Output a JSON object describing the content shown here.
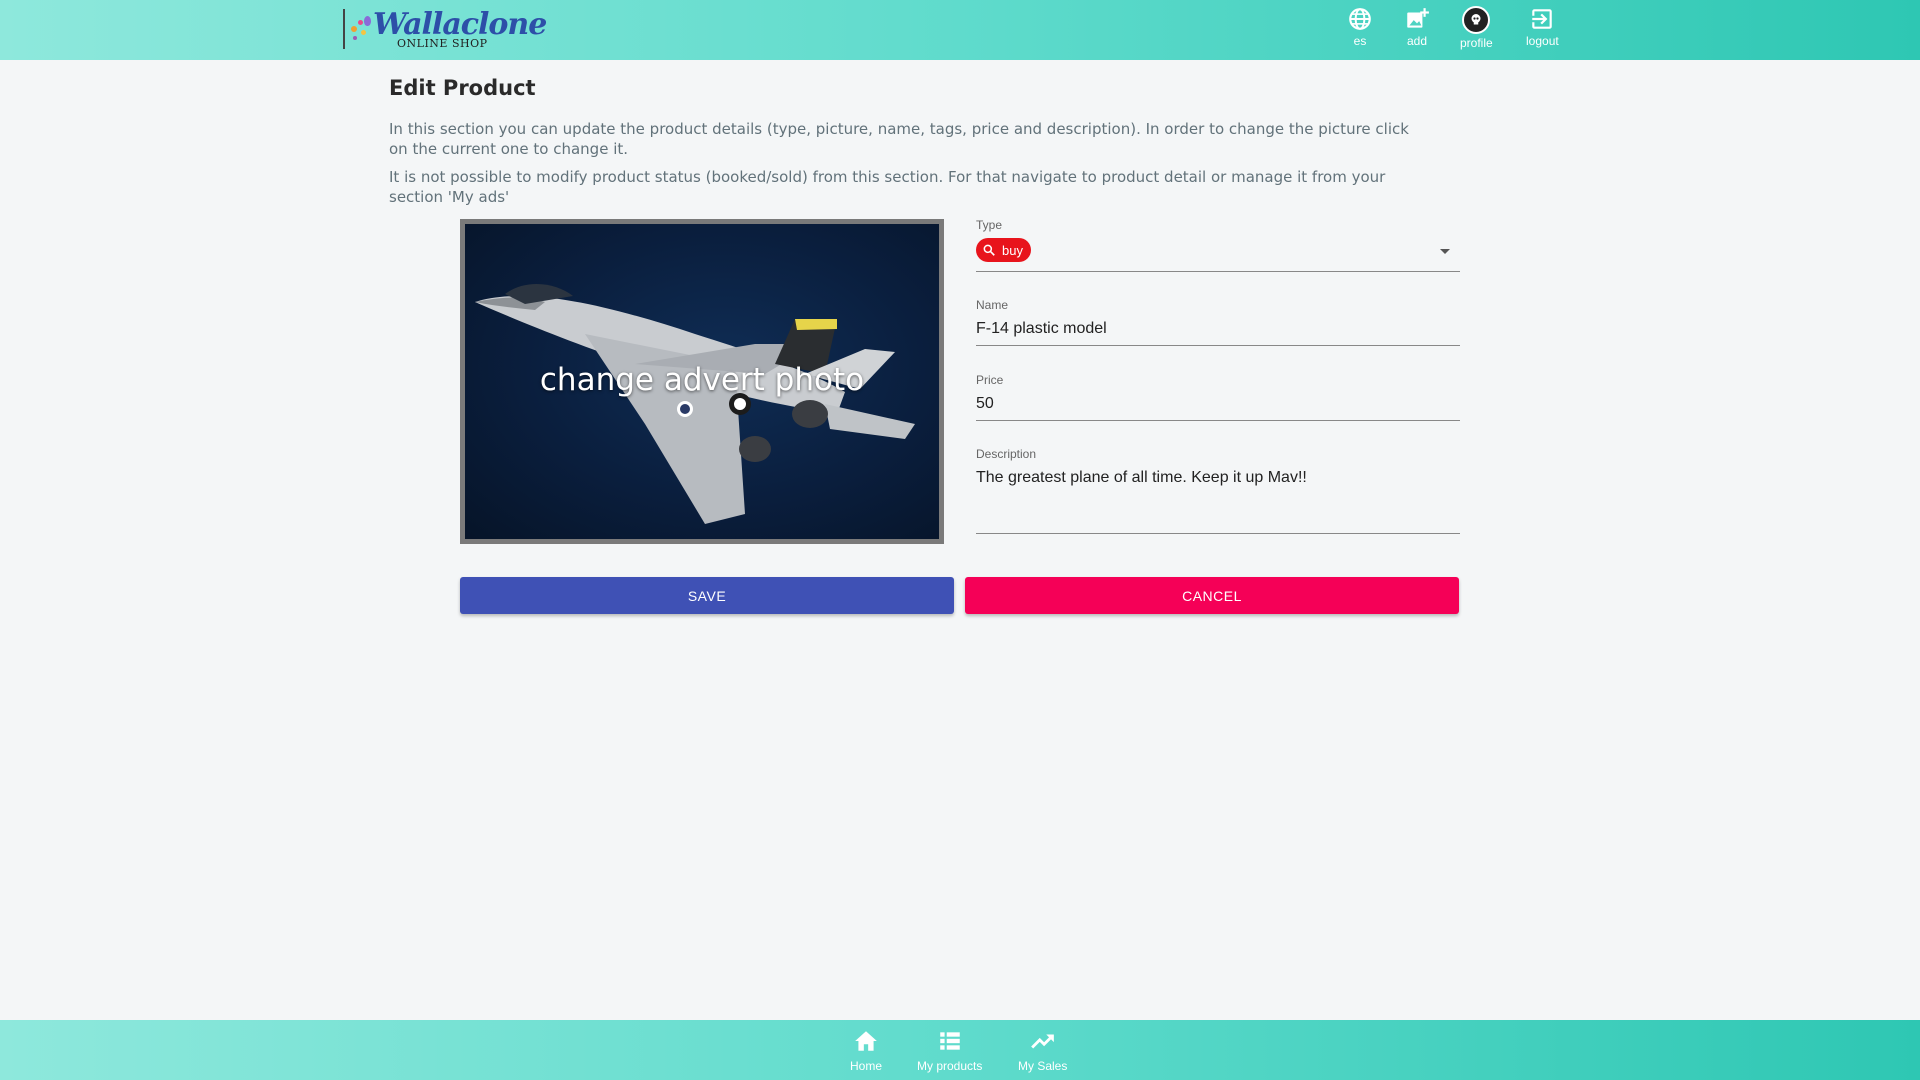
{
  "header": {
    "logo_main": "Wallaclone",
    "logo_sub": "ONLINE SHOP",
    "nav": [
      {
        "label": "es",
        "icon": "globe-icon"
      },
      {
        "label": "add",
        "icon": "add-photo-icon"
      },
      {
        "label": "profile",
        "icon": "avatar"
      },
      {
        "label": "logout",
        "icon": "logout-icon"
      }
    ],
    "gradient": [
      "#8ee8dc",
      "#2ec7b3"
    ]
  },
  "main": {
    "title": "Edit Product",
    "intro_1": "In this section you can update the product details (type, picture, name, tags, price and description). In order to change the picture click on the current one to change it.",
    "intro_2": "It is not possible to modify product status (booked/sold) from this section. For that navigate to product detail or manage it from your section 'My ads'",
    "photo_overlay": "change advert photo"
  },
  "form": {
    "type_label": "Type",
    "type_value": "buy",
    "type_chip_color": "#e8141c",
    "name_label": "Name",
    "name_value": "F-14 plastic model",
    "price_label": "Price",
    "price_value": "50",
    "description_label": "Description",
    "description_value": "The greatest plane of all time. Keep it up Mav!!"
  },
  "actions": {
    "save_label": "SAVE",
    "save_color": "#3f51b5",
    "cancel_label": "CANCEL",
    "cancel_color": "#f50057"
  },
  "bottom_nav": [
    {
      "label": "Home",
      "icon": "home-icon"
    },
    {
      "label": "My products",
      "icon": "list-icon"
    },
    {
      "label": "My Sales",
      "icon": "trending-up-icon"
    }
  ]
}
